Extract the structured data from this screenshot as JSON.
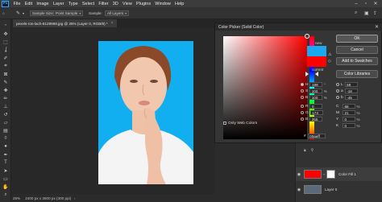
{
  "menubar": {
    "logo": "Ps",
    "items": [
      "File",
      "Edit",
      "Image",
      "Layer",
      "Type",
      "Select",
      "Filter",
      "3D",
      "View",
      "Plugins",
      "Window",
      "Help"
    ]
  },
  "options": {
    "sample_size_label": "Sample Size:",
    "sample_size_value": "Point Sample",
    "sample_label": "Sample:",
    "sample_value": "All Layers"
  },
  "document": {
    "tab_title": "pexels-ron-lach-8129969.jpg @ 25% (Layer 0, RGB/8) *",
    "status_zoom": "25%",
    "status_size": "2400 px x 3600 px (300 ppi)"
  },
  "color_picker": {
    "title": "Color Picker (Solid Color)",
    "new_label": "new",
    "current_label": "current",
    "ok_label": "OK",
    "cancel_label": "Cancel",
    "add_swatches_label": "Add to Swatches",
    "libraries_label": "Color Libraries",
    "only_web_colors_label": "Only Web Colors",
    "new_color": "#1aa8f0",
    "current_color": "#ff0000",
    "hsb": [
      {
        "key": "H",
        "value": "198",
        "unit": "°"
      },
      {
        "key": "S",
        "value": "100",
        "unit": "%"
      },
      {
        "key": "B",
        "value": "100",
        "unit": "%"
      }
    ],
    "rgb": [
      {
        "key": "R",
        "value": "0",
        "unit": ""
      },
      {
        "key": "G",
        "value": "174",
        "unit": ""
      },
      {
        "key": "B",
        "value": "255",
        "unit": ""
      }
    ],
    "lab": [
      {
        "key": "L",
        "value": "69",
        "unit": ""
      },
      {
        "key": "a",
        "value": "-18",
        "unit": ""
      },
      {
        "key": "b",
        "value": "-45",
        "unit": ""
      }
    ],
    "cmyk": [
      {
        "key": "C",
        "value": "68",
        "unit": "%"
      },
      {
        "key": "M",
        "value": "21",
        "unit": "%"
      },
      {
        "key": "Y",
        "value": "0",
        "unit": "%"
      },
      {
        "key": "K",
        "value": "0",
        "unit": "%"
      }
    ],
    "hex_label": "#",
    "hex_value": "00aeff"
  },
  "layers": {
    "items": [
      {
        "name": "Color Fill 1",
        "color": "#ff0000"
      },
      {
        "name": "Layer 0",
        "color": "#5a6a78"
      }
    ]
  }
}
